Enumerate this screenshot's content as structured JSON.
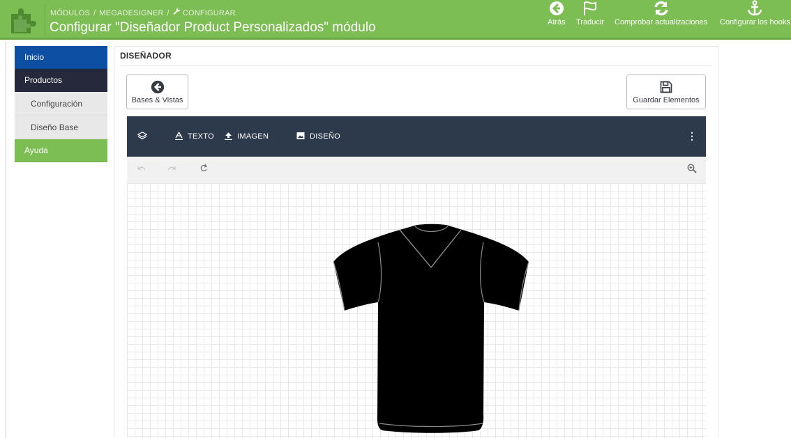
{
  "header": {
    "breadcrumb": [
      "MÓDULOS",
      "MEGADESIGNER",
      "CONFIGURAR"
    ],
    "title": "Configurar \"Diseñador Product Personalizados\" módulo",
    "actions": [
      {
        "label": "Atrás",
        "icon": "arrow-circle-left-icon"
      },
      {
        "label": "Traducir",
        "icon": "flag-icon"
      },
      {
        "label": "Comprobar actualizaciones",
        "icon": "refresh-icon"
      },
      {
        "label": "Configurar los hooks",
        "icon": "anchor-icon"
      }
    ]
  },
  "sidebar": {
    "items": [
      {
        "label": "Inicio"
      },
      {
        "label": "Productos"
      },
      {
        "label": "Configuración"
      },
      {
        "label": "Diseño Base"
      },
      {
        "label": "Ayuda"
      }
    ]
  },
  "panel": {
    "title": "DISEÑADOR",
    "bases_button": "Bases & Vistas",
    "save_button": "Guardar Elementos",
    "tools": [
      {
        "label": "TEXTO",
        "icon": "text-icon"
      },
      {
        "label": "IMAGEN",
        "icon": "upload-icon"
      },
      {
        "label": "DISEÑO",
        "icon": "image-icon"
      }
    ],
    "more": "⋮"
  },
  "colors": {
    "header_green": "#7cbd54",
    "sidebar_blue": "#0d4fa3",
    "sidebar_dark": "#26283b",
    "designer_bar": "#2d3a4b"
  }
}
